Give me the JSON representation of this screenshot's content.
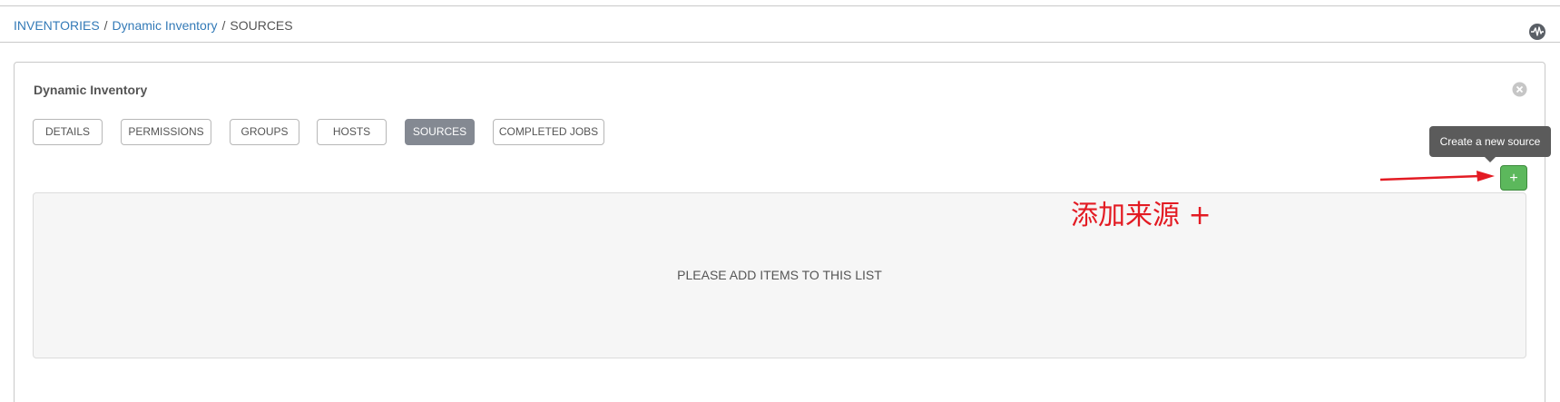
{
  "breadcrumb": {
    "items": [
      "INVENTORIES",
      "Dynamic Inventory",
      "SOURCES"
    ],
    "separator": "/"
  },
  "header": {
    "activity_icon": "activity-stream-icon"
  },
  "panel": {
    "title": "Dynamic Inventory",
    "close_icon": "close-icon"
  },
  "tabs": [
    {
      "label": "DETAILS",
      "active": false
    },
    {
      "label": "PERMISSIONS",
      "active": false
    },
    {
      "label": "GROUPS",
      "active": false
    },
    {
      "label": "HOSTS",
      "active": false
    },
    {
      "label": "SOURCES",
      "active": true
    },
    {
      "label": "COMPLETED JOBS",
      "active": false
    }
  ],
  "toolbar": {
    "add_label": "+",
    "add_tooltip": "Create a new source"
  },
  "annotation": {
    "text": "添加来源 +",
    "color": "#e31b23"
  },
  "list": {
    "empty_text": "PLEASE ADD ITEMS TO THIS LIST"
  },
  "colors": {
    "link": "#337ab7",
    "active_tab": "#848992",
    "add_button": "#5cb85c",
    "tooltip": "#5b5b5b"
  }
}
